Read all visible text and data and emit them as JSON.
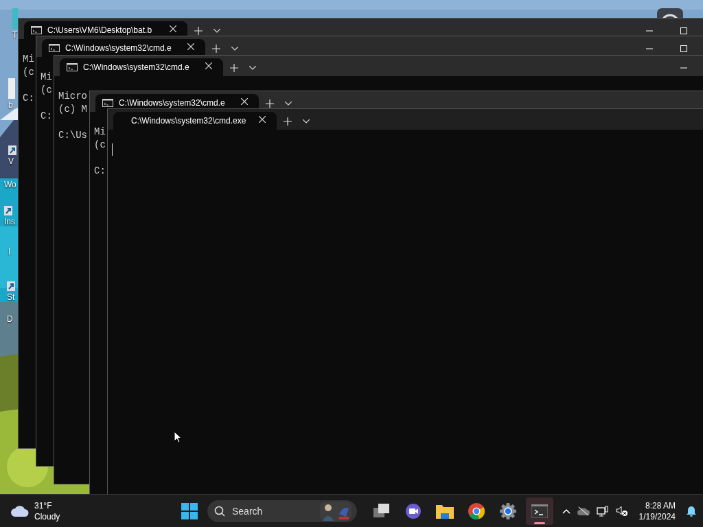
{
  "desktop": {
    "icons": [
      {
        "kind": "app",
        "label": "T"
      },
      {
        "kind": "file",
        "label": "b"
      },
      {
        "kind": "shortcut",
        "label": "V"
      },
      {
        "kind": "text",
        "label": "Wo"
      },
      {
        "kind": "shortcut",
        "label": "Ins"
      },
      {
        "kind": "text",
        "label": "I"
      },
      {
        "kind": "shortcut",
        "label": "St"
      },
      {
        "kind": "text",
        "label": "D"
      },
      {
        "kind": "disc"
      }
    ]
  },
  "windows": [
    {
      "tab": {
        "title": "C:\\Users\\VM6\\Desktop\\bat.b",
        "has_icon": true
      },
      "controls": [
        {
          "kind": "minimize"
        },
        {
          "kind": "maximize"
        }
      ],
      "paragraphs": [
        [
          "Mi",
          "(c"
        ],
        [
          "C:"
        ]
      ]
    },
    {
      "tab": {
        "title": "C:\\Windows\\system32\\cmd.e",
        "has_icon": true
      },
      "controls": [
        {
          "kind": "minimize"
        },
        {
          "kind": "maximize"
        }
      ],
      "paragraphs": [
        [
          "Mi",
          "(c"
        ],
        [
          "C:"
        ]
      ]
    },
    {
      "tab": {
        "title": "C:\\Windows\\system32\\cmd.e",
        "has_icon": true
      },
      "controls": [
        {
          "kind": "minimize"
        }
      ],
      "paragraphs": [
        [
          "Micro",
          "(c) M"
        ],
        [
          "C:\\Us"
        ]
      ]
    },
    {
      "tab": {
        "title": "C:\\Windows\\system32\\cmd.e",
        "has_icon": true
      },
      "paragraphs": [
        [
          "Mi",
          "(c"
        ],
        [
          "C:"
        ]
      ]
    },
    {
      "tab": {
        "title": "C:\\Windows\\system32\\cmd.exe",
        "has_icon": false
      },
      "cursor": true
    }
  ],
  "taskbar": {
    "weather": {
      "temperature": "31°F",
      "condition": "Cloudy"
    },
    "search": {
      "placeholder": "Search"
    },
    "apps": [
      {
        "kind": "taskview",
        "selected": false
      },
      {
        "kind": "meet",
        "selected": false
      },
      {
        "kind": "explorer",
        "selected": false
      },
      {
        "kind": "chrome",
        "selected": false
      },
      {
        "kind": "settings",
        "selected": false
      },
      {
        "kind": "terminal",
        "selected": true
      }
    ],
    "clock": {
      "time": "8:28 AM",
      "date": "1/19/2024"
    }
  }
}
